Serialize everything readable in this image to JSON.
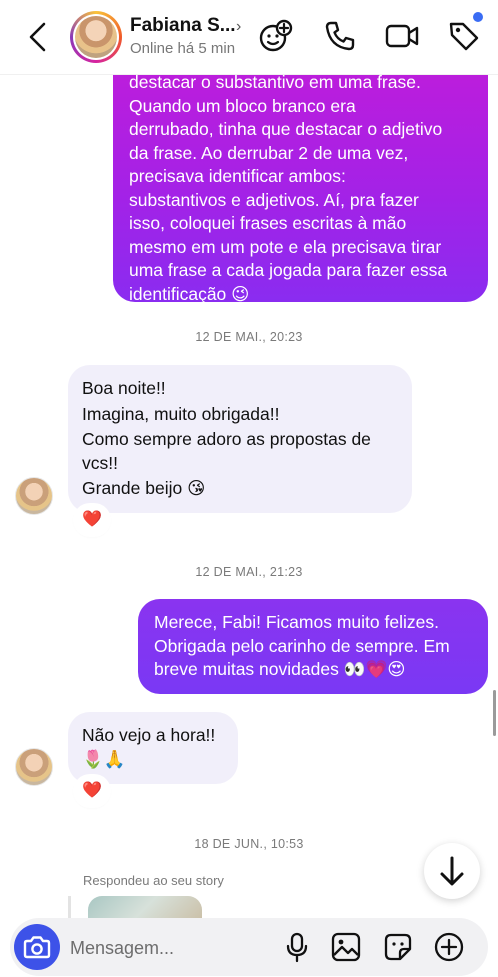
{
  "header": {
    "contact_name": "Fabiana S...",
    "status": "Online há 5 min",
    "chevron": "›",
    "icons": [
      "back-chevron-icon",
      "effects-face-add-icon",
      "phone-icon",
      "video-icon",
      "tag-icon"
    ],
    "accent_dot_color": "#3a6cf4"
  },
  "messages": {
    "first_outgoing": {
      "lines": [
        "destacar o substantivo em uma frase.",
        "Quando um bloco branco era",
        "derrubado, tinha que destacar o adjetivo",
        "da frase. Ao derrubar 2 de uma vez,",
        "precisava identificar ambos:",
        "substantivos e adjetivos. Aí, pra fazer",
        "isso, coloquei frases escritas à mão",
        "mesmo em um pote e ela precisava tirar",
        "uma frase a cada jogada para fazer essa",
        "identificação 😉"
      ],
      "color": "#b31fe0"
    },
    "timestamp_1": "12 DE MAI., 20:23",
    "incoming_1": {
      "lines": [
        "Boa noite!!",
        "Imagina, muito obrigada!!",
        "Como sempre adoro as propostas de",
        "vcs!!",
        "Grande beijo 😘"
      ],
      "reaction": "❤️"
    },
    "timestamp_2": "12 DE MAI., 21:23",
    "outgoing_2": {
      "lines": [
        "Merece, Fabi! Ficamos muito felizes.",
        "Obrigada pelo carinho de sempre. Em",
        "breve muitas novidades 👀💗😍"
      ],
      "color": "#8036f2"
    },
    "incoming_2": {
      "lines": [
        "Não vejo a hora!!",
        "🌷🙏"
      ],
      "reaction": "❤️"
    },
    "timestamp_3": "18 DE JUN., 10:53",
    "story_reply_label": "Respondeu ao seu story"
  },
  "composer": {
    "placeholder": "Mensagem...",
    "icons": [
      "camera-icon",
      "microphone-icon",
      "gallery-icon",
      "sticker-icon",
      "add-icon"
    ],
    "camera_color": "#3d52e8"
  },
  "scroll_down_icon": "arrow-down-icon"
}
